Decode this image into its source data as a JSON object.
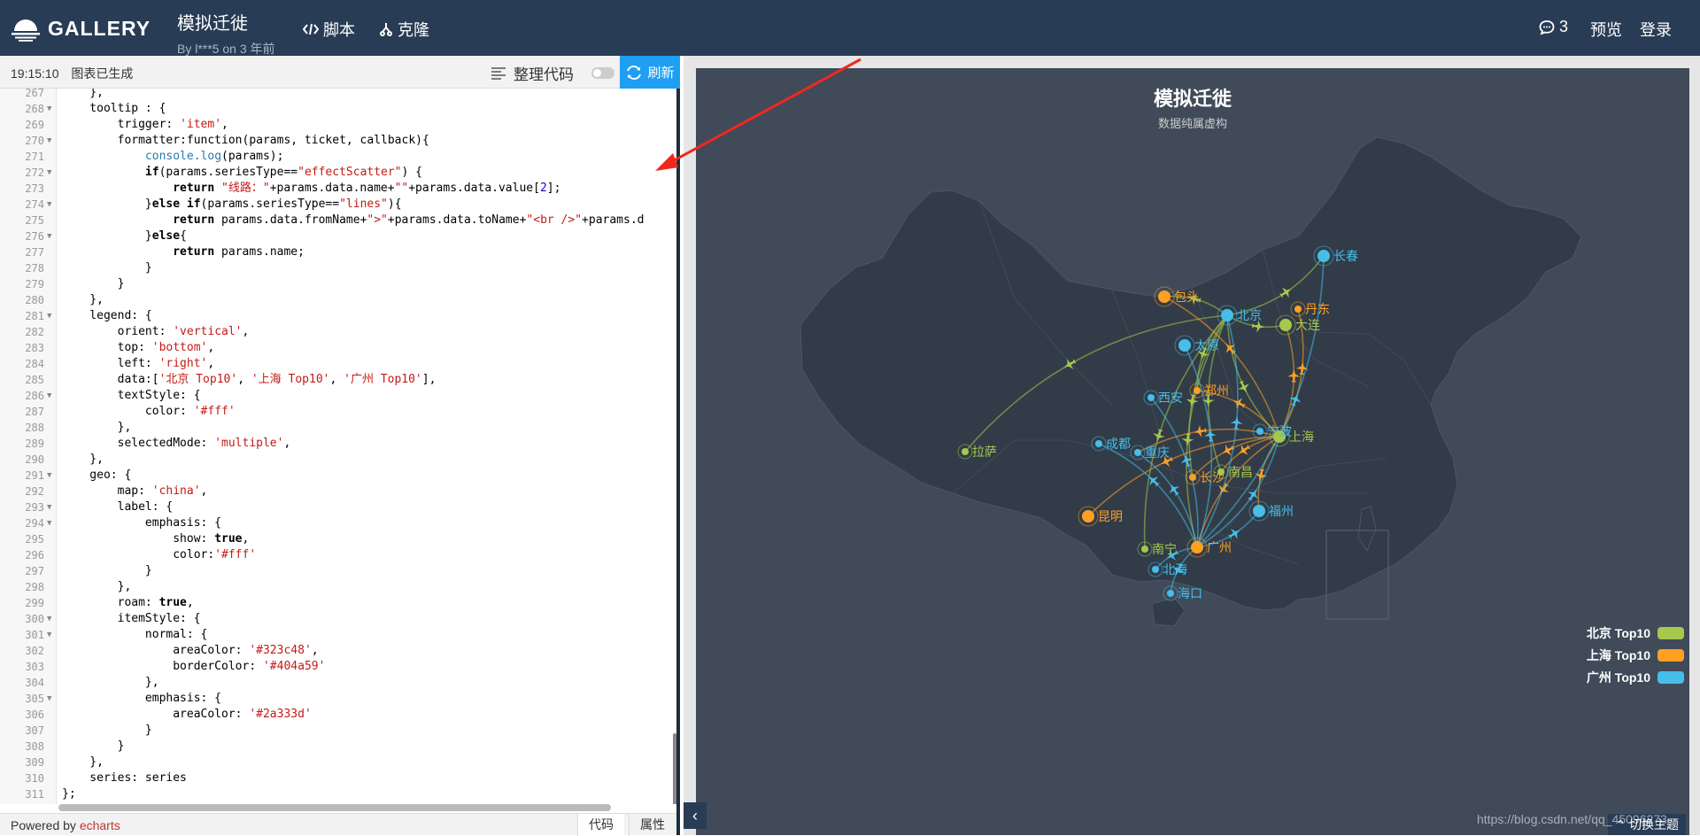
{
  "header": {
    "logo_text": "GALLERY",
    "title": "模拟迁徙",
    "subtitle": "By l***5 on 3 年前",
    "nav": {
      "script": "脚本",
      "clone": "克隆"
    },
    "comments_count": "3",
    "preview": "预览",
    "login": "登录"
  },
  "toolbar": {
    "status_time": "19:15:10",
    "status_text": "图表已生成",
    "format_label": "整理代码",
    "refresh_label": "刷新"
  },
  "code": {
    "lines": [
      {
        "n": "267",
        "fold": false,
        "t": "    },"
      },
      {
        "n": "268",
        "fold": true,
        "t": "    tooltip : {"
      },
      {
        "n": "269",
        "fold": false,
        "t": "        trigger: 'item',"
      },
      {
        "n": "270",
        "fold": true,
        "t": "        formatter:function(params, ticket, callback){"
      },
      {
        "n": "271",
        "fold": false,
        "t": "            console.log(params);"
      },
      {
        "n": "272",
        "fold": true,
        "t": "            if(params.seriesType==\"effectScatter\") {"
      },
      {
        "n": "273",
        "fold": false,
        "t": "                return \"线路：\"+params.data.name+\"\"+params.data.value[2];"
      },
      {
        "n": "274",
        "fold": true,
        "t": "            }else if(params.seriesType==\"lines\"){"
      },
      {
        "n": "275",
        "fold": false,
        "t": "                return params.data.fromName+\">\"+params.data.toName+\"<br />\"+params.d"
      },
      {
        "n": "276",
        "fold": true,
        "t": "            }else{"
      },
      {
        "n": "277",
        "fold": false,
        "t": "                return params.name;"
      },
      {
        "n": "278",
        "fold": false,
        "t": "            }"
      },
      {
        "n": "279",
        "fold": false,
        "t": "        }"
      },
      {
        "n": "280",
        "fold": false,
        "t": "    },"
      },
      {
        "n": "281",
        "fold": true,
        "t": "    legend: {"
      },
      {
        "n": "282",
        "fold": false,
        "t": "        orient: 'vertical',"
      },
      {
        "n": "283",
        "fold": false,
        "t": "        top: 'bottom',"
      },
      {
        "n": "284",
        "fold": false,
        "t": "        left: 'right',"
      },
      {
        "n": "285",
        "fold": false,
        "t": "        data:['北京 Top10', '上海 Top10', '广州 Top10'],"
      },
      {
        "n": "286",
        "fold": true,
        "t": "        textStyle: {"
      },
      {
        "n": "287",
        "fold": false,
        "t": "            color: '#fff'"
      },
      {
        "n": "288",
        "fold": false,
        "t": "        },"
      },
      {
        "n": "289",
        "fold": false,
        "t": "        selectedMode: 'multiple',"
      },
      {
        "n": "290",
        "fold": false,
        "t": "    },"
      },
      {
        "n": "291",
        "fold": true,
        "t": "    geo: {"
      },
      {
        "n": "292",
        "fold": false,
        "t": "        map: 'china',"
      },
      {
        "n": "293",
        "fold": true,
        "t": "        label: {"
      },
      {
        "n": "294",
        "fold": true,
        "t": "            emphasis: {"
      },
      {
        "n": "295",
        "fold": false,
        "t": "                show: true,"
      },
      {
        "n": "296",
        "fold": false,
        "t": "                color:'#fff'"
      },
      {
        "n": "297",
        "fold": false,
        "t": "            }"
      },
      {
        "n": "298",
        "fold": false,
        "t": "        },"
      },
      {
        "n": "299",
        "fold": false,
        "t": "        roam: true,"
      },
      {
        "n": "300",
        "fold": true,
        "t": "        itemStyle: {"
      },
      {
        "n": "301",
        "fold": true,
        "t": "            normal: {"
      },
      {
        "n": "302",
        "fold": false,
        "t": "                areaColor: '#323c48',"
      },
      {
        "n": "303",
        "fold": false,
        "t": "                borderColor: '#404a59'"
      },
      {
        "n": "304",
        "fold": false,
        "t": "            },"
      },
      {
        "n": "305",
        "fold": true,
        "t": "            emphasis: {"
      },
      {
        "n": "306",
        "fold": false,
        "t": "                areaColor: '#2a333d'"
      },
      {
        "n": "307",
        "fold": false,
        "t": "            }"
      },
      {
        "n": "308",
        "fold": false,
        "t": "        }"
      },
      {
        "n": "309",
        "fold": false,
        "t": "    },"
      },
      {
        "n": "310",
        "fold": false,
        "t": "    series: series"
      },
      {
        "n": "311",
        "fold": false,
        "t": "};"
      }
    ]
  },
  "footer": {
    "powered_prefix": "Powered by",
    "powered_link": "echarts",
    "tab_code": "代码",
    "tab_props": "属性"
  },
  "chart": {
    "title": "模拟迁徙",
    "subtitle": "数据纯属虚构",
    "legend": [
      {
        "label": "北京 Top10",
        "color": "#a6c84c"
      },
      {
        "label": "上海 Top10",
        "color": "#ffa022"
      },
      {
        "label": "广州 Top10",
        "color": "#46bee9"
      }
    ],
    "theme_button": "切换主题",
    "watermark": "https://blog.csdn.net/qq_45096273",
    "colors": {
      "background": "#404a59",
      "area": "#323c48",
      "border": "#404a59"
    },
    "cities": [
      "长春",
      "包头",
      "北京",
      "丹东",
      "大连",
      "太原",
      "西安",
      "郑州",
      "成都",
      "重庆",
      "拉萨",
      "上海",
      "宁波",
      "南昌",
      "长沙",
      "福州",
      "昆明",
      "南宁",
      "广州",
      "北海",
      "海口"
    ]
  }
}
